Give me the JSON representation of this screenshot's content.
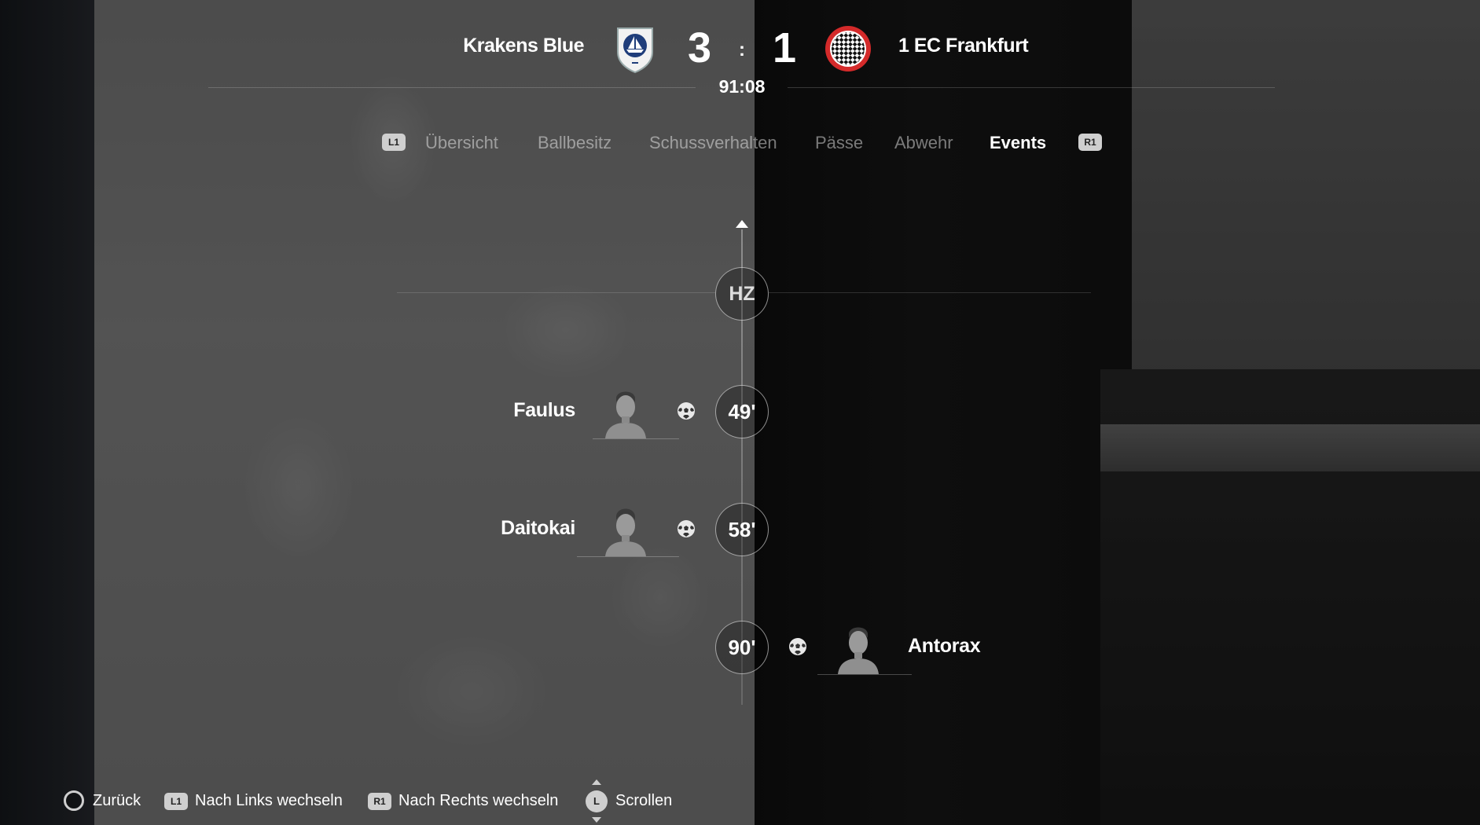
{
  "match": {
    "home": {
      "name": "Krakens Blue",
      "score": "3",
      "crest_icon": "ship-shield-crest",
      "crest_color": "#1f3d7a"
    },
    "away": {
      "name": "1 EC Frankfurt",
      "score": "1",
      "crest_icon": "checkered-circle-crest",
      "crest_color": "#d42a2a"
    },
    "separator": ":",
    "clock": "91:08"
  },
  "tabs": {
    "prev_button": "L1",
    "next_button": "R1",
    "items": [
      {
        "label": "Übersicht",
        "active": false
      },
      {
        "label": "Ballbesitz",
        "active": false
      },
      {
        "label": "Schussverhalten",
        "active": false
      },
      {
        "label": "Pässe",
        "active": false
      },
      {
        "label": "Abwehr",
        "active": false
      },
      {
        "label": "Events",
        "active": true
      }
    ]
  },
  "timeline": {
    "halftime_label": "HZ",
    "events": [
      {
        "minute": "49'",
        "player": "Faulus",
        "team": "home",
        "type": "goal",
        "icon": "ball-icon"
      },
      {
        "minute": "58'",
        "player": "Daitokai",
        "team": "home",
        "type": "goal",
        "icon": "ball-icon"
      },
      {
        "minute": "90'",
        "player": "Antorax",
        "team": "away",
        "type": "goal",
        "icon": "ball-icon"
      }
    ]
  },
  "footer": {
    "back": {
      "button": "circle",
      "label": "Zurück"
    },
    "left": {
      "button": "L1",
      "label": "Nach Links wechseln"
    },
    "right": {
      "button": "R1",
      "label": "Nach Rechts wechseln"
    },
    "scroll": {
      "button": "L",
      "label": "Scrollen"
    }
  },
  "colors": {
    "accent_home": "#1f3d7a",
    "accent_away": "#d42a2a",
    "tab_inactive": "#8c8c8c",
    "tab_active": "#ffffff"
  }
}
